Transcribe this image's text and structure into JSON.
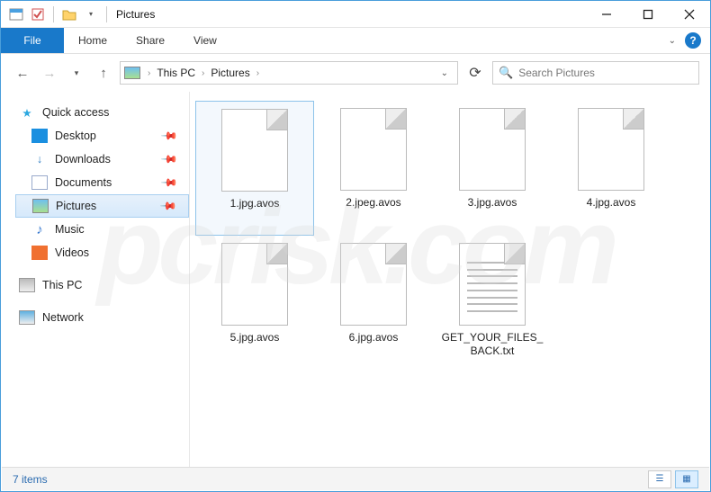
{
  "window": {
    "title": "Pictures"
  },
  "ribbon": {
    "file": "File",
    "tabs": [
      "Home",
      "Share",
      "View"
    ]
  },
  "breadcrumb": {
    "nodes": [
      "This PC",
      "Pictures"
    ]
  },
  "search": {
    "placeholder": "Search Pictures"
  },
  "sidebar": {
    "quick_access": {
      "label": "Quick access"
    },
    "items": [
      {
        "label": "Desktop",
        "icon": "desk",
        "pinned": true
      },
      {
        "label": "Downloads",
        "icon": "dl",
        "pinned": true
      },
      {
        "label": "Documents",
        "icon": "doc",
        "pinned": true
      },
      {
        "label": "Pictures",
        "icon": "pic",
        "pinned": true,
        "active": true
      },
      {
        "label": "Music",
        "icon": "mus",
        "pinned": false
      },
      {
        "label": "Videos",
        "icon": "vid",
        "pinned": false
      }
    ],
    "this_pc": {
      "label": "This PC"
    },
    "network": {
      "label": "Network"
    }
  },
  "files": [
    {
      "name": "1.jpg.avos",
      "type": "unknown",
      "selected": true
    },
    {
      "name": "2.jpeg.avos",
      "type": "unknown"
    },
    {
      "name": "3.jpg.avos",
      "type": "unknown"
    },
    {
      "name": "4.jpg.avos",
      "type": "unknown"
    },
    {
      "name": "5.jpg.avos",
      "type": "unknown"
    },
    {
      "name": "6.jpg.avos",
      "type": "unknown"
    },
    {
      "name": "GET_YOUR_FILES_BACK.txt",
      "type": "txt"
    }
  ],
  "status": {
    "text": "7 items"
  },
  "watermark": "pcrisk.com"
}
